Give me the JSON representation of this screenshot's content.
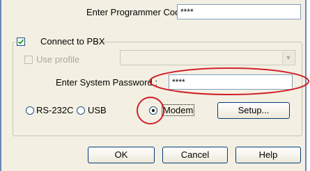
{
  "programmer_code": {
    "label": "Enter Programmer Code :",
    "value": "****"
  },
  "connect_pbx": {
    "label": "Connect to PBX",
    "checked": true
  },
  "use_profile": {
    "label": "Use profile",
    "checked": false,
    "enabled": false
  },
  "system_password": {
    "label": "Enter System Password :",
    "value": "****"
  },
  "connection_types": [
    {
      "label": "RS-232C",
      "selected": false
    },
    {
      "label": "USB",
      "selected": false
    },
    {
      "label": "Modem",
      "selected": true
    }
  ],
  "buttons": {
    "setup": "Setup...",
    "ok": "OK",
    "cancel": "Cancel",
    "help": "Help"
  },
  "colors": {
    "annotation": "#d0202a",
    "dialog_bg": "#f3f0e3",
    "frame": "#6b87b7"
  },
  "icons": {
    "check": "check-mark-icon",
    "dropdown": "chevron-down-icon"
  }
}
